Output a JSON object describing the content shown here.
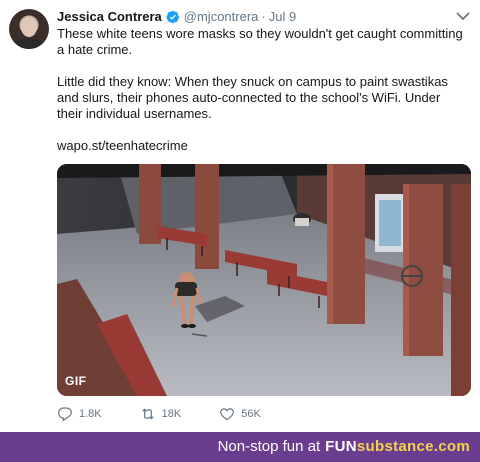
{
  "tweet": {
    "author_name": "Jessica Contrera",
    "handle": "@mjcontrera",
    "separator": "·",
    "date": "Jul 9",
    "paragraphs": [
      "These white teens wore masks so they wouldn't get caught committing a hate crime.",
      "Little did they know: When they snuck on campus to paint swastikas and slurs, their phones auto-connected to the school's WiFi. Under their individual usernames."
    ],
    "link": "wapo.st/teenhatecrime",
    "media_badge": "GIF",
    "actions": {
      "replies": "1.8K",
      "retweets": "18K",
      "likes": "56K"
    }
  },
  "footer": {
    "tagline": "Non-stop fun at",
    "brand_left": "FUN",
    "brand_right": "substance.com"
  },
  "colors": {
    "verified_blue": "#1da1f2",
    "secondary_text": "#657786",
    "footer_purple": "#6b3d8e",
    "brand_yellow": "#f3d24a"
  },
  "icons": [
    "verified-badge-icon",
    "chevron-down-icon",
    "reply-icon",
    "retweet-icon",
    "like-icon"
  ]
}
